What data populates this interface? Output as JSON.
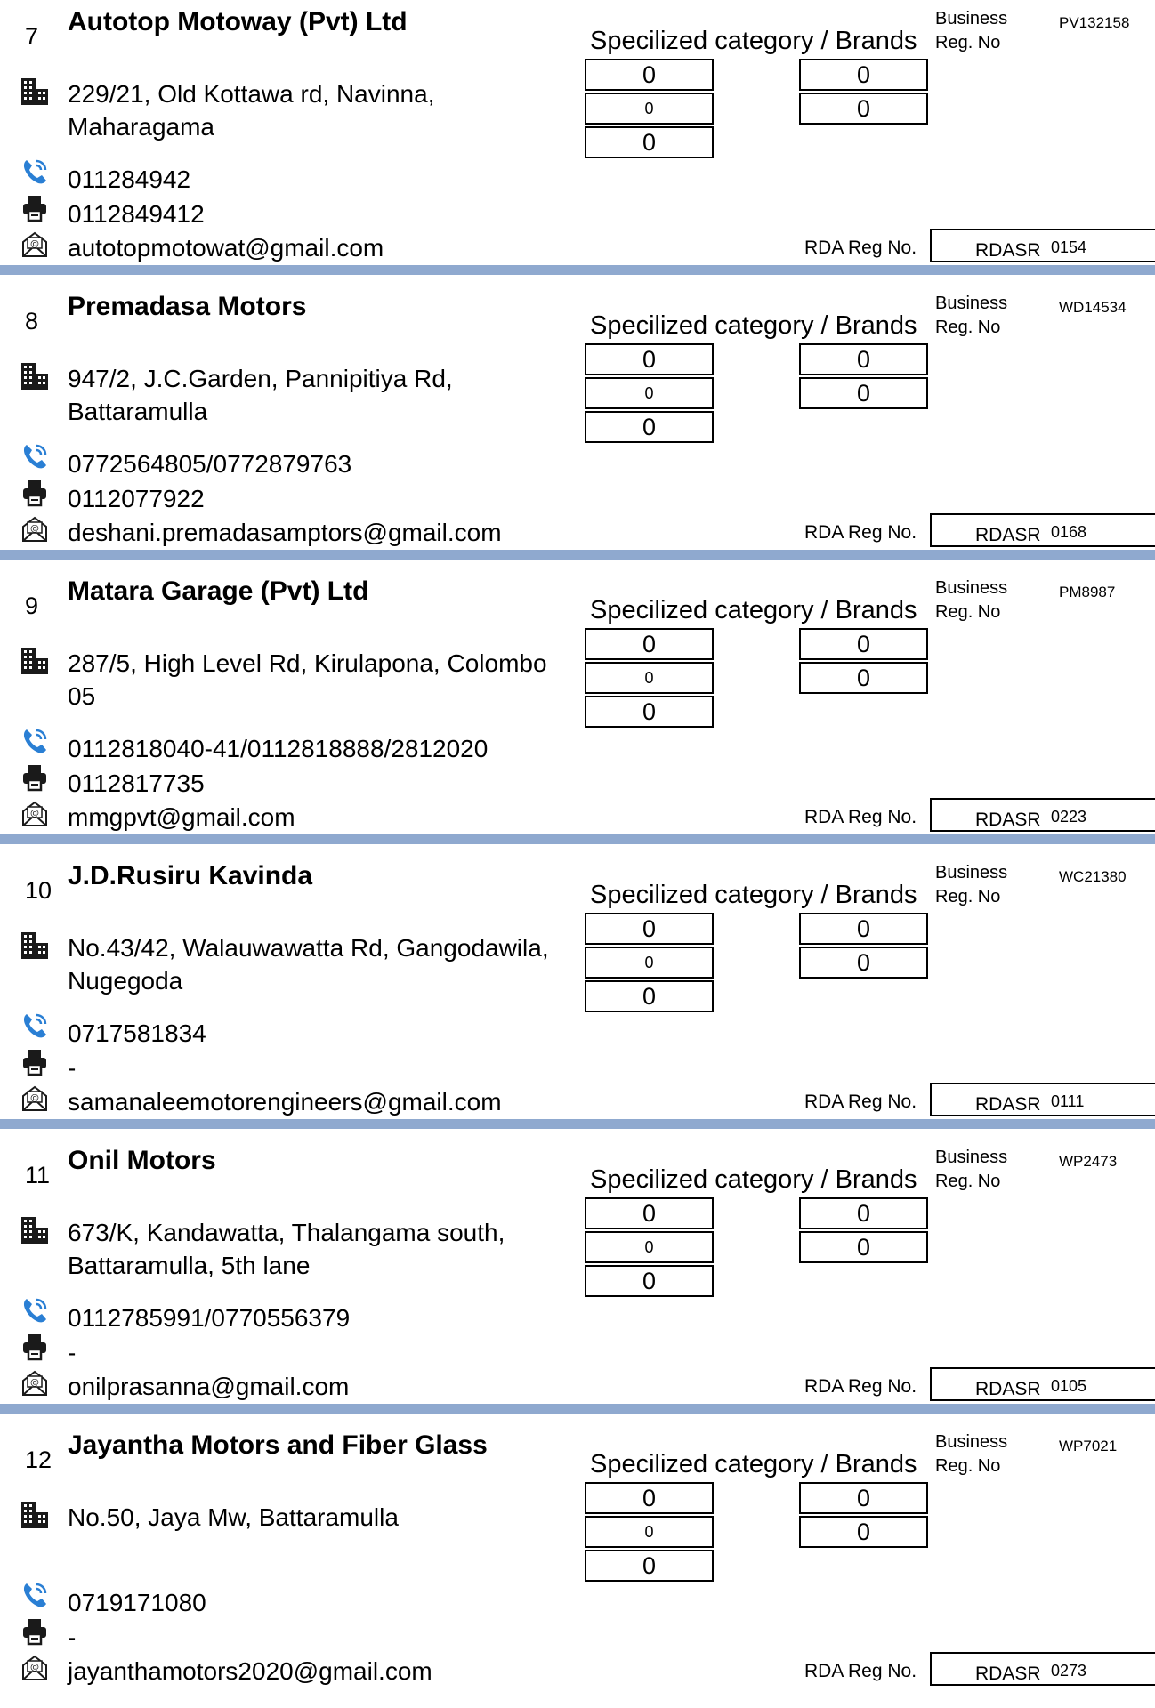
{
  "labels": {
    "specialized": "Specilized category / Brands",
    "business": "Business",
    "reg_no": "Reg. No",
    "rda_reg_no": "RDA Reg No.",
    "rdasr": "RDASR"
  },
  "icons": {
    "address": "building-icon",
    "phone": "phone-icon",
    "fax": "fax-icon",
    "email": "email-icon"
  },
  "colors": {
    "separator": "#8fa9cf",
    "phone_icon": "#2a7fd4"
  },
  "entries": [
    {
      "number": "7",
      "name": "Autotop Motoway (Pvt) Ltd",
      "address": "229/21, Old Kottawa rd, Navinna, Maharagama",
      "phone": "011284942",
      "fax": "0112849412",
      "email": "autotopmotowat@gmail.com",
      "business_reg_no": "PV132158",
      "rda_number": "0154",
      "box_values": [
        "0",
        "0",
        "0",
        "0",
        "0"
      ]
    },
    {
      "number": "8",
      "name": "Premadasa Motors",
      "address": "947/2, J.C.Garden, Pannipitiya Rd, Battaramulla",
      "phone": "0772564805/0772879763",
      "fax": "0112077922",
      "email": "deshani.premadasamptors@gmail.com",
      "business_reg_no": "WD14534",
      "rda_number": "0168",
      "box_values": [
        "0",
        "0",
        "0",
        "0",
        "0"
      ]
    },
    {
      "number": "9",
      "name": "Matara Garage (Pvt) Ltd",
      "address": "287/5, High Level Rd, Kirulapona, Colombo 05",
      "phone": "0112818040-41/0112818888/2812020",
      "fax": "0112817735",
      "email": "mmgpvt@gmail.com",
      "business_reg_no": "PM8987",
      "rda_number": "0223",
      "box_values": [
        "0",
        "0",
        "0",
        "0",
        "0"
      ]
    },
    {
      "number": "10",
      "name": "J.D.Rusiru Kavinda",
      "address": "No.43/42, Walauwawatta Rd, Gangodawila, Nugegoda",
      "phone": "0717581834",
      "fax": "-",
      "email": "samanaleemotorengineers@gmail.com",
      "business_reg_no": "WC21380",
      "rda_number": "0111",
      "box_values": [
        "0",
        "0",
        "0",
        "0",
        "0"
      ]
    },
    {
      "number": "11",
      "name": "Onil Motors",
      "address": "673/K, Kandawatta, Thalangama south, Battaramulla, 5th lane",
      "phone": "0112785991/0770556379",
      "fax": "-",
      "email": "onilprasanna@gmail.com",
      "business_reg_no": "WP2473",
      "rda_number": "0105",
      "box_values": [
        "0",
        "0",
        "0",
        "0",
        "0"
      ]
    },
    {
      "number": "12",
      "name": "Jayantha Motors and Fiber Glass",
      "address": "No.50, Jaya Mw, Battaramulla",
      "phone": "0719171080",
      "fax": "-",
      "email": "jayanthamotors2020@gmail.com",
      "business_reg_no": "WP7021",
      "rda_number": "0273",
      "box_values": [
        "0",
        "0",
        "0",
        "0",
        "0"
      ]
    }
  ]
}
